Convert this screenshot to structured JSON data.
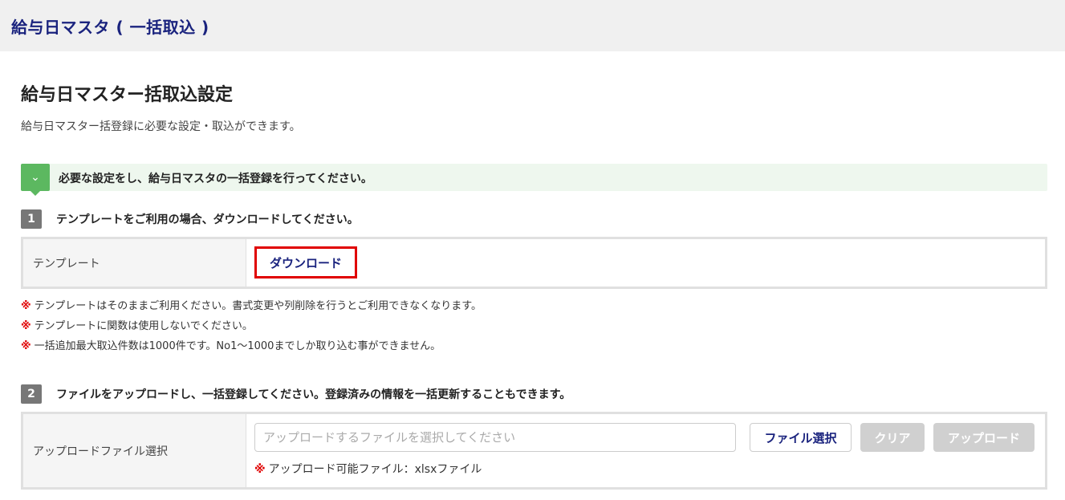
{
  "header": {
    "title": "給与日マスタ ( 一括取込 )"
  },
  "page": {
    "title": "給与日マスター括取込設定",
    "description": "給与日マスター括登録に必要な設定・取込ができます。"
  },
  "notice": {
    "icon": "chevron-down-icon",
    "icon_glyph": "⌄",
    "text": "必要な設定をし、給与日マスタの一括登録を行ってください。"
  },
  "step1": {
    "number": "1",
    "text": "テンプレートをご利用の場合、ダウンロードしてください。",
    "row_label": "テンプレート",
    "download_label": "ダウンロード",
    "notes": [
      "テンプレートはそのままご利用ください。書式変更や列削除を行うとご利用できなくなります。",
      "テンプレートに関数は使用しないでください。",
      "一括追加最大取込件数は1000件です。No1～1000までしか取り込む事ができません。"
    ],
    "note_mark": "※"
  },
  "step2": {
    "number": "2",
    "text": "ファイルをアップロードし、一括登録してください。登録済みの情報を一括更新することもできます。",
    "row_label": "アップロードファイル選択",
    "input_placeholder": "アップロードするファイルを選択してください",
    "select_button": "ファイル選択",
    "clear_button": "クリア",
    "upload_button": "アップロード",
    "note_mark": "※",
    "note": "アップロード可能ファイル：xlsxファイル"
  },
  "colors": {
    "title_navy": "#1a237e",
    "highlight_red": "#e00000",
    "notice_green": "#5cb860",
    "disabled_gray": "#d0d0d0"
  }
}
